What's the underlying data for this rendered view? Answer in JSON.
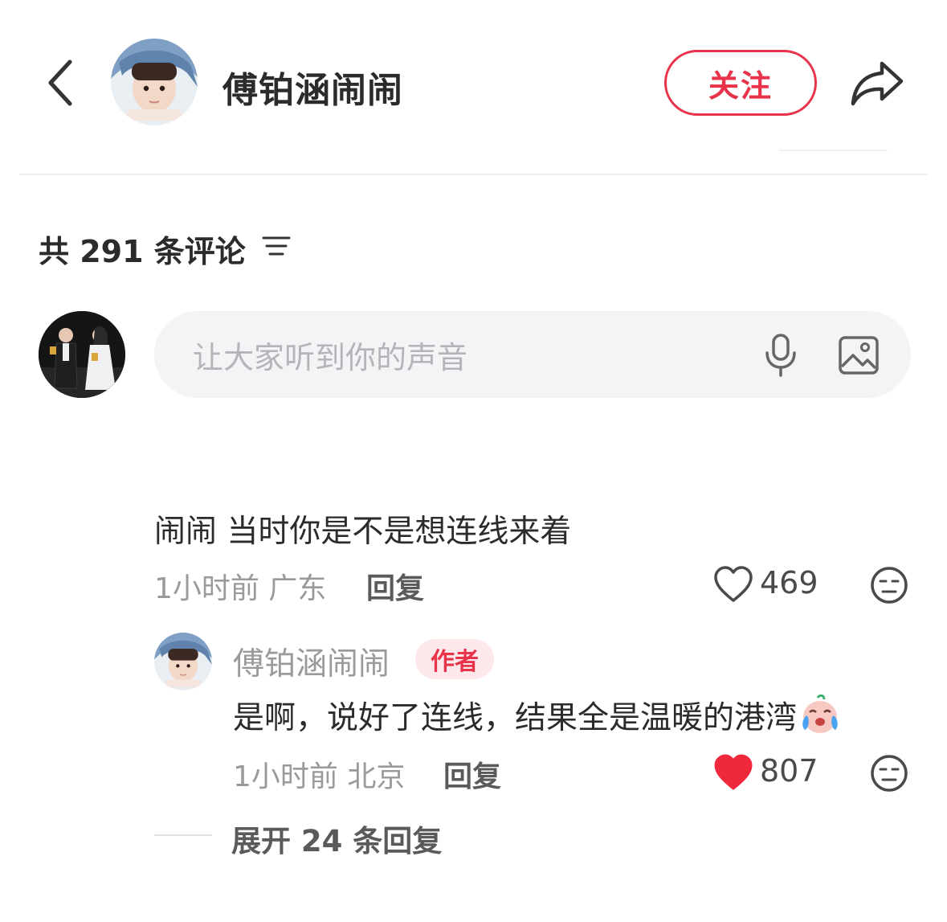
{
  "header": {
    "author_name": "傅铂涵闹闹",
    "follow_label": "关注"
  },
  "comments_section": {
    "count_label": "共 291 条评论",
    "input_placeholder": "让大家听到你的声音"
  },
  "comment": {
    "text": "闹闹 当时你是不是想连线来着",
    "time_location": "1小时前 广东",
    "reply_label": "回复",
    "likes": "469",
    "liked": false
  },
  "reply": {
    "author_name": "傅铂涵闹闹",
    "badge": "作者",
    "text": "是啊，说好了连线，结果全是温暖的港湾",
    "time_location": "1小时前 北京",
    "reply_label": "回复",
    "likes": "807",
    "liked": true
  },
  "expand": {
    "label": "展开 24 条回复"
  },
  "colors": {
    "accent": "#e8334a",
    "text_primary": "#2b2b2b",
    "text_secondary": "#9a9a9a",
    "input_bg": "#f4f4f6",
    "like_active": "#f0283c"
  },
  "icons": {
    "back": "chevron-left-icon",
    "share": "share-arrow-icon",
    "sort": "sort-lines-icon",
    "mic": "microphone-icon",
    "image": "image-icon",
    "like": "heart-icon",
    "emoji": "emoji-face-icon",
    "crying_emoji": "crying-face-emoji"
  }
}
